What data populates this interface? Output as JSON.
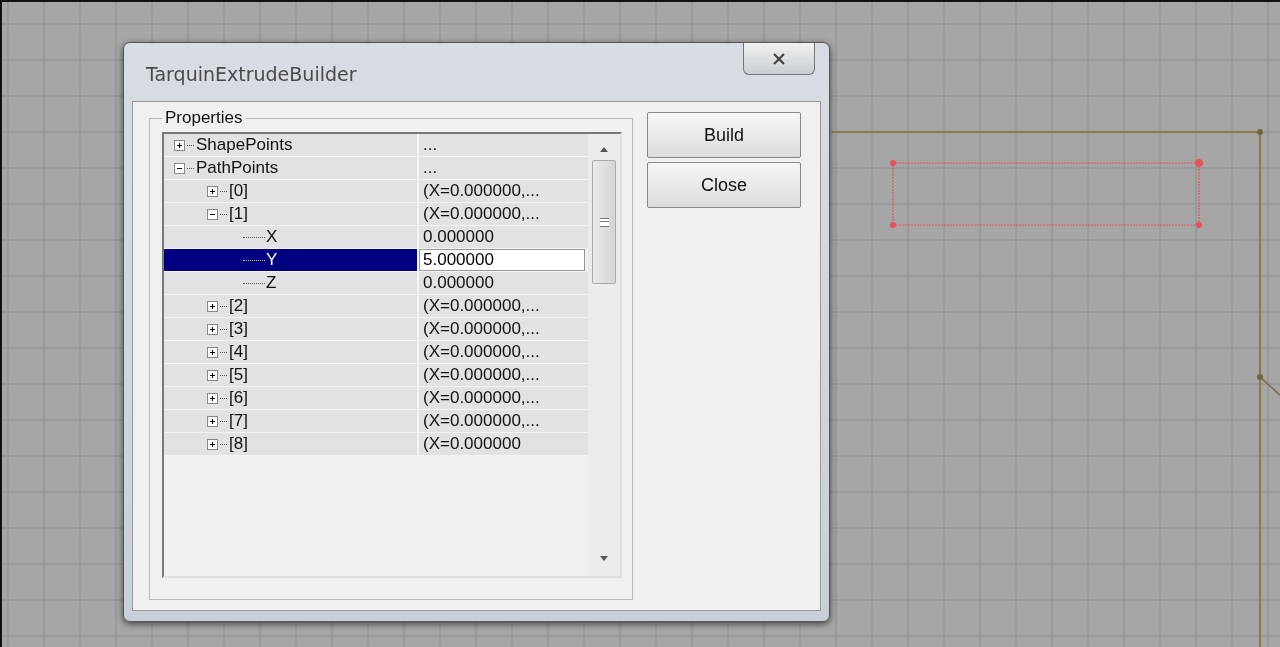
{
  "window": {
    "title": "TarquinExtrudeBuilder"
  },
  "group": {
    "label": "Properties"
  },
  "properties": [
    {
      "name": "ShapePoints",
      "value": "...",
      "expanded": false,
      "selected": false
    },
    {
      "name": "PathPoints",
      "value": "...",
      "expanded": true,
      "selected": false,
      "children": [
        {
          "name": "[0]",
          "value": "(X=0.000000,...",
          "expanded": false,
          "selected": false
        },
        {
          "name": "[1]",
          "value": "(X=0.000000,...",
          "expanded": true,
          "selected": false,
          "children": [
            {
              "name": "X",
              "value": "0.000000",
              "selected": false
            },
            {
              "name": "Y",
              "value": "5.000000",
              "selected": true
            },
            {
              "name": "Z",
              "value": "0.000000",
              "selected": false
            }
          ]
        },
        {
          "name": "[2]",
          "value": "(X=0.000000,...",
          "expanded": false,
          "selected": false
        },
        {
          "name": "[3]",
          "value": "(X=0.000000,...",
          "expanded": false,
          "selected": false
        },
        {
          "name": "[4]",
          "value": "(X=0.000000,...",
          "expanded": false,
          "selected": false
        },
        {
          "name": "[5]",
          "value": "(X=0.000000,...",
          "expanded": false,
          "selected": false
        },
        {
          "name": "[6]",
          "value": "(X=0.000000,...",
          "expanded": false,
          "selected": false
        },
        {
          "name": "[7]",
          "value": "(X=0.000000,...",
          "expanded": false,
          "selected": false
        },
        {
          "name": "[8]",
          "value": "(X=0.000000",
          "expanded": false,
          "selected": false
        }
      ]
    }
  ],
  "buttons": [
    {
      "label": "Build"
    },
    {
      "label": "Close"
    }
  ]
}
